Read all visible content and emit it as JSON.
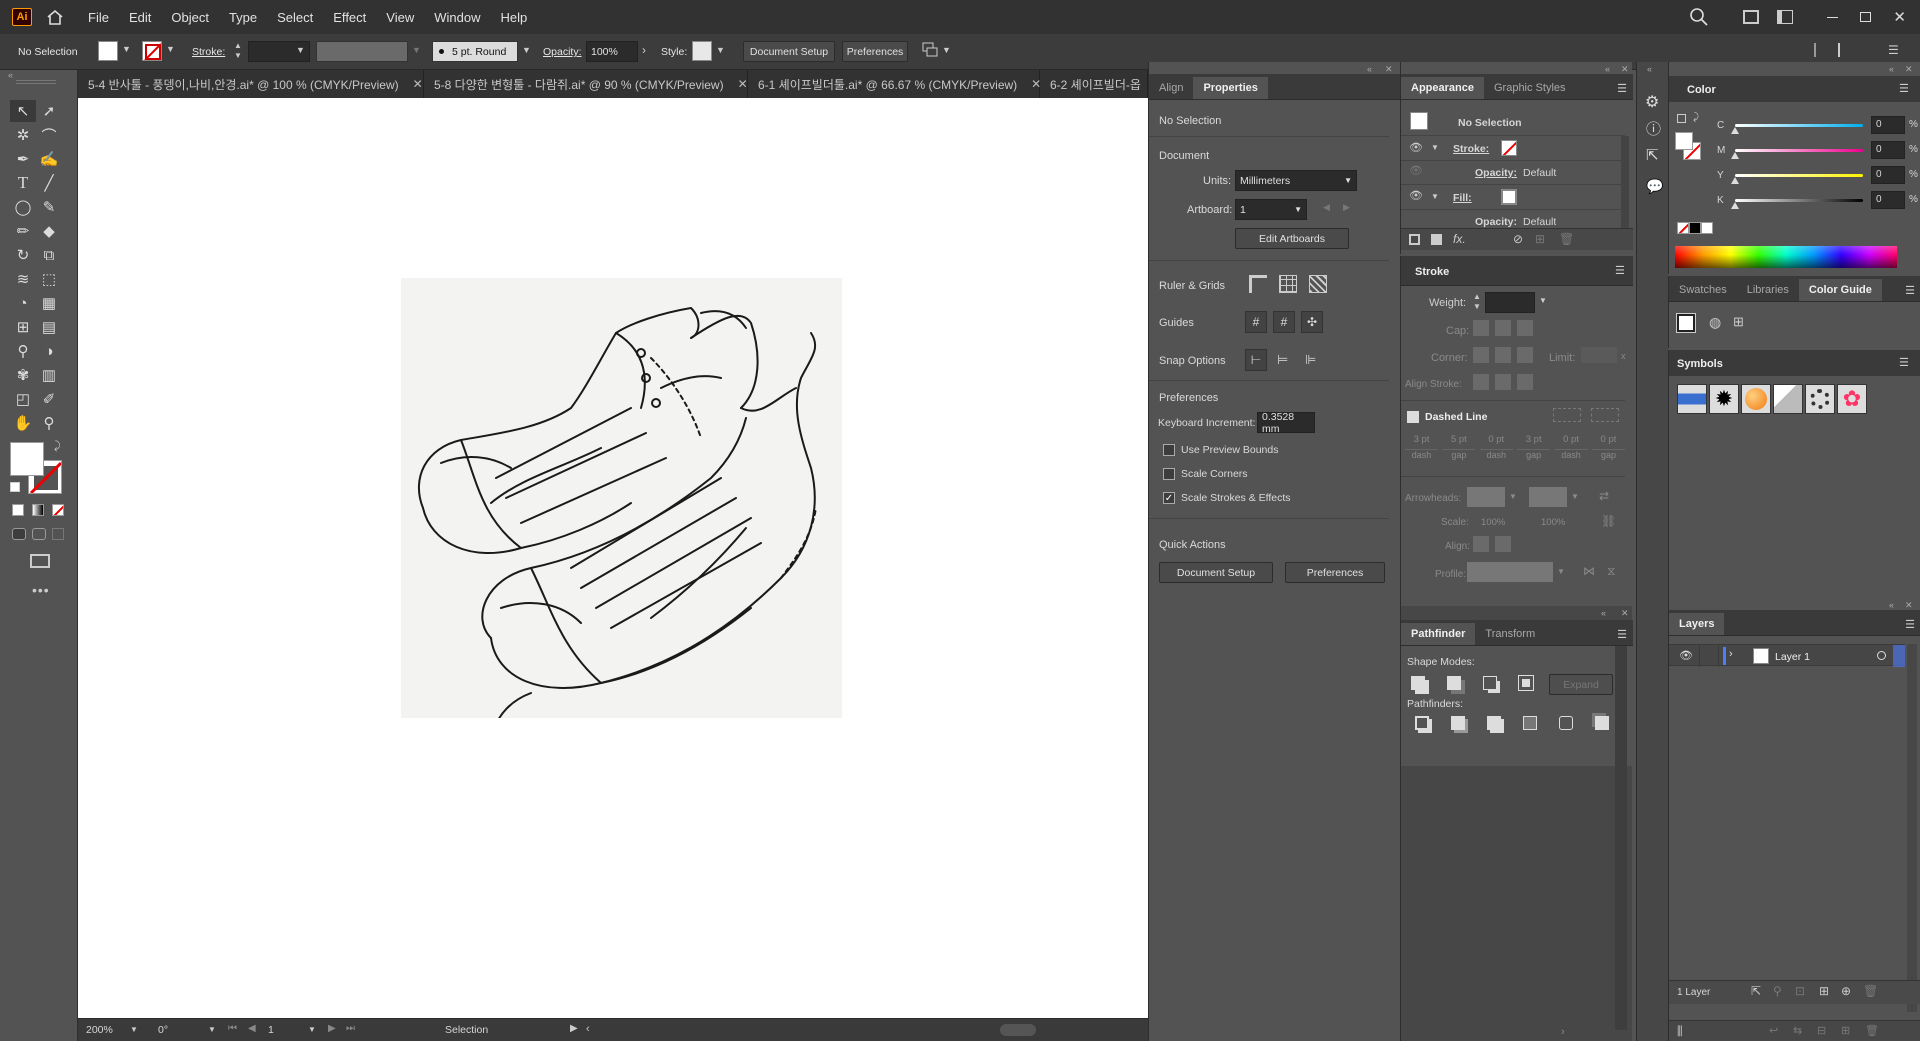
{
  "menubar": {
    "logo": "Ai",
    "items": [
      "File",
      "Edit",
      "Object",
      "Type",
      "Select",
      "Effect",
      "View",
      "Window",
      "Help"
    ]
  },
  "control": {
    "selection": "No Selection",
    "stroke_label": "Stroke:",
    "brush": "5 pt. Round",
    "opacity_label": "Opacity:",
    "opacity_value": "100%",
    "style_label": "Style:",
    "doc_setup": "Document Setup",
    "preferences": "Preferences"
  },
  "tabs": [
    {
      "label": "5-4 반사툴 - 풍뎅이,나비,안경.ai* @ 100 % (CMYK/Preview)"
    },
    {
      "label": "5-8 다양한 변형툴 - 다람쥐.ai* @ 90 % (CMYK/Preview)"
    },
    {
      "label": "6-1 셰이프빌더툴.ai* @ 66.67 % (CMYK/Preview)"
    },
    {
      "label": "6-2 셰이프빌더-옵"
    }
  ],
  "status": {
    "zoom": "200%",
    "rotation": "0°",
    "artboard": "1",
    "tool": "Selection"
  },
  "properties": {
    "tabs": [
      "Align",
      "Properties"
    ],
    "no_selection": "No Selection",
    "document": "Document",
    "units_label": "Units:",
    "units_value": "Millimeters",
    "artboard_label": "Artboard:",
    "artboard_value": "1",
    "edit_artboards": "Edit Artboards",
    "ruler_grids": "Ruler & Grids",
    "guides": "Guides",
    "snap_options": "Snap Options",
    "preferences": "Preferences",
    "keyboard_increment_label": "Keyboard Increment:",
    "keyboard_increment_value": "0.3528 mm",
    "use_preview_bounds": "Use Preview Bounds",
    "scale_corners": "Scale Corners",
    "scale_strokes": "Scale Strokes & Effects",
    "quick_actions": "Quick Actions",
    "qa_doc_setup": "Document Setup",
    "qa_preferences": "Preferences"
  },
  "appearance": {
    "tabs": [
      "Appearance",
      "Graphic Styles"
    ],
    "no_selection": "No Selection",
    "stroke": "Stroke:",
    "opacity": "Opacity:",
    "default": "Default",
    "fill": "Fill:",
    "opacity2": "Opacity:",
    "default2": "Default"
  },
  "stroke_panel": {
    "title": "Stroke",
    "weight": "Weight:",
    "cap": "Cap:",
    "corner": "Corner:",
    "limit": "Limit:",
    "align_stroke": "Align Stroke:",
    "dashed_line": "Dashed Line",
    "dash_vals": [
      "3 pt",
      "5 pt",
      "0 pt",
      "3 pt",
      "0 pt",
      "0 pt"
    ],
    "dash_labels": [
      "dash",
      "gap",
      "dash",
      "gap",
      "dash",
      "gap"
    ],
    "arrowheads": "Arrowheads:",
    "scale": "Scale:",
    "scale1": "100%",
    "scale2": "100%",
    "align": "Align:",
    "profile": "Profile:"
  },
  "pathfinder": {
    "tabs": [
      "Pathfinder",
      "Transform"
    ],
    "shape_modes": "Shape Modes:",
    "expand": "Expand",
    "pathfinders": "Pathfinders:"
  },
  "color": {
    "title": "Color",
    "channels": [
      {
        "label": "C",
        "value": "0",
        "pct": "%",
        "color": "#00aeef"
      },
      {
        "label": "M",
        "value": "0",
        "pct": "%",
        "color": "#ec008c"
      },
      {
        "label": "Y",
        "value": "0",
        "pct": "%",
        "color": "#fff200"
      },
      {
        "label": "K",
        "value": "0",
        "pct": "%",
        "color": "#000000"
      }
    ]
  },
  "swatches": {
    "tabs": [
      "Swatches",
      "Libraries",
      "Color Guide"
    ]
  },
  "symbols": {
    "title": "Symbols"
  },
  "layers": {
    "title": "Layers",
    "layer_name": "Layer 1",
    "count": "1 Layer"
  }
}
